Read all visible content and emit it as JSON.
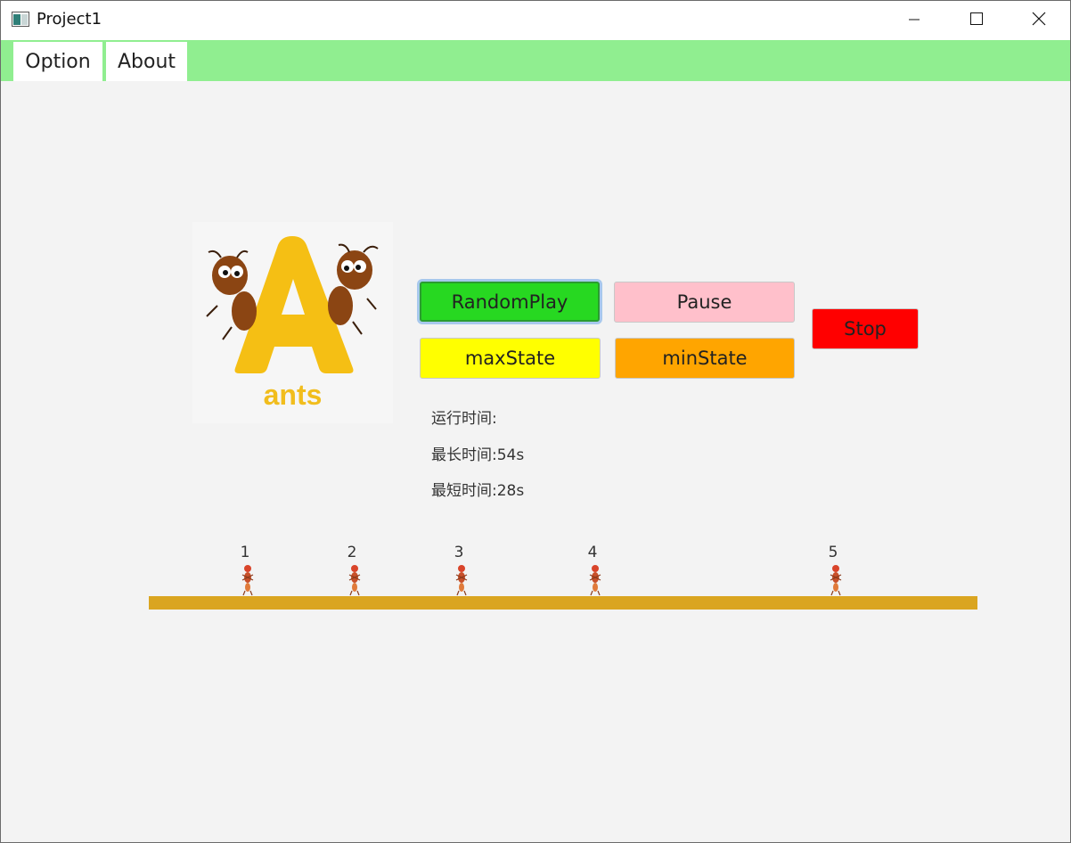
{
  "window": {
    "title": "Project1",
    "controls": [
      "minimize-icon",
      "maximize-icon",
      "close-icon"
    ]
  },
  "menubar": {
    "background": "#90ee90",
    "items": [
      {
        "label": "Option"
      },
      {
        "label": "About"
      }
    ]
  },
  "logo": {
    "caption": "ants"
  },
  "buttons": {
    "random_play": {
      "label": "RandomPlay",
      "color": "#27d821"
    },
    "pause": {
      "label": "Pause",
      "color": "#ffc0cb"
    },
    "stop": {
      "label": "Stop",
      "color": "#ff0000"
    },
    "max_state": {
      "label": "maxState",
      "color": "#ffff00"
    },
    "min_state": {
      "label": "minState",
      "color": "#ffa500"
    }
  },
  "stats": {
    "run_time": {
      "label": "运行时间:",
      "value": ""
    },
    "max_time": {
      "label": "最长时间:",
      "value": "54s"
    },
    "min_time": {
      "label": "最短时间:",
      "value": "28s"
    }
  },
  "track": {
    "color": "#daa520",
    "ants": [
      {
        "number": "1"
      },
      {
        "number": "2"
      },
      {
        "number": "3"
      },
      {
        "number": "4"
      },
      {
        "number": "5"
      }
    ]
  }
}
